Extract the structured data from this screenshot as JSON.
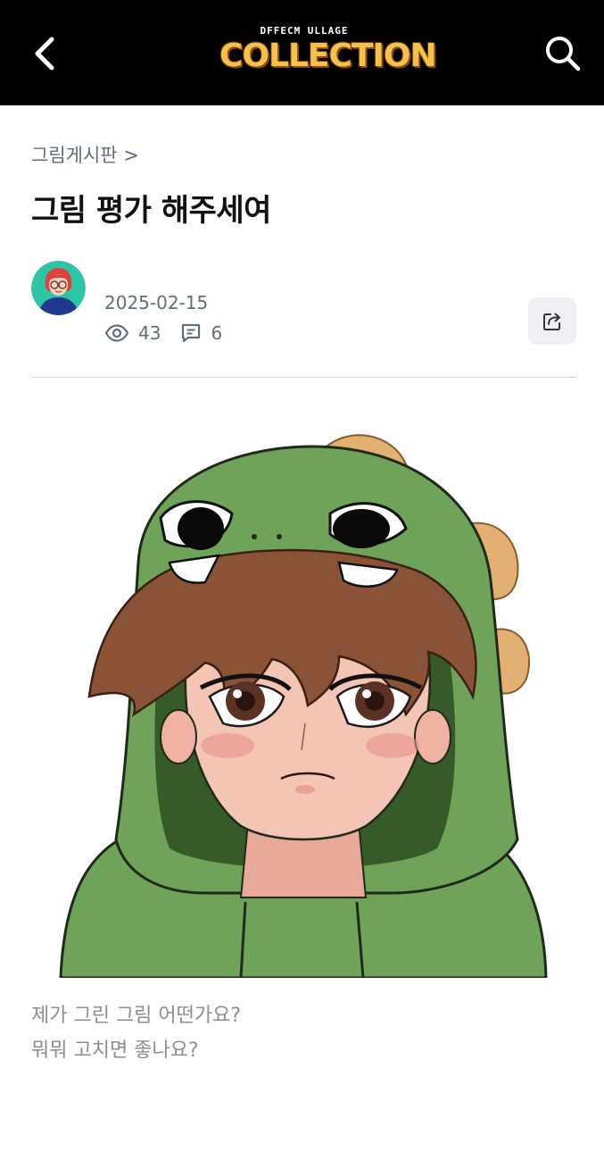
{
  "header": {
    "logo_top_text": "DFFECM ULLAGE",
    "logo_main_text": "COLLECTION",
    "back_icon": "chevron-left-icon",
    "search_icon": "search-icon"
  },
  "post": {
    "breadcrumb": "그림게시판 >",
    "title": "그림 평가 해주세여",
    "date": "2025-02-15",
    "views": "43",
    "comments": "6",
    "body_lines": [
      "제가 그린 그림 어떤가요?",
      "뭐뭐 고치면 좋나요?"
    ]
  },
  "colors": {
    "header_bg": "#000000",
    "meta_text": "#5e6e80",
    "body_text": "#8a8f96",
    "share_bg": "#eef0f4",
    "avatar_bg": "#2ec4a6",
    "hood_green": "#6fa35a"
  }
}
